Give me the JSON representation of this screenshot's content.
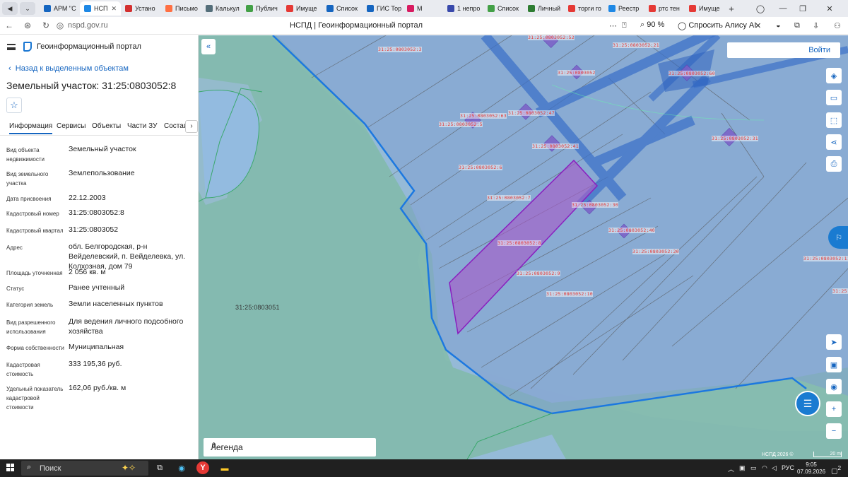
{
  "browser": {
    "tabs": [
      {
        "label": "АРМ \"С",
        "color": "#1565c0"
      },
      {
        "label": "НСП",
        "color": "#1e88e5",
        "active": true
      },
      {
        "label": "Устано",
        "color": "#d32f2f"
      },
      {
        "label": "Письмо",
        "color": "#ff7043"
      },
      {
        "label": "Калькул",
        "color": "#546e7a"
      },
      {
        "label": "Публич",
        "color": "#43a047"
      },
      {
        "label": "Имуще",
        "color": "#e53935"
      },
      {
        "label": "Список",
        "color": "#1565c0"
      },
      {
        "label": "ГИС Тор",
        "color": "#1565c0"
      },
      {
        "label": "М",
        "color": "#d81b60"
      },
      {
        "label": "1 непро",
        "color": "#3949ab"
      },
      {
        "label": "Список",
        "color": "#43a047"
      },
      {
        "label": "Личный",
        "color": "#2e7d32"
      },
      {
        "label": "торги го",
        "color": "#e53935"
      },
      {
        "label": "Реестр",
        "color": "#1e88e5"
      },
      {
        "label": "ртс тен",
        "color": "#e53935"
      },
      {
        "label": "Имуще",
        "color": "#e53935"
      }
    ],
    "url": "nspd.gov.ru",
    "page_title": "НСПД | Геоинформационный портал",
    "zoom": "90 %",
    "alice": "Спросить Алису AI"
  },
  "panel": {
    "portal_name": "Геоинформационный портал",
    "back_link": "Назад к выделенным объектам",
    "title": "Земельный участок: 31:25:0803052:8",
    "tabs": [
      "Информация",
      "Сервисы",
      "Объекты",
      "Части ЗУ",
      "Состав"
    ],
    "attributes": [
      {
        "label": "Вид объекта недвижимости",
        "value": "Земельный участок"
      },
      {
        "label": "Вид земельного участка",
        "value": "Землепользование"
      },
      {
        "label": "Дата присвоения",
        "value": "22.12.2003"
      },
      {
        "label": "Кадастровый номер",
        "value": "31:25:0803052:8"
      },
      {
        "label": "Кадастровый квартал",
        "value": "31:25:0803052"
      },
      {
        "label": "Адрес",
        "value": "обл. Белгородская, р-н Вейделевский, п. Вейделевка, ул. Колхозная, дом 79"
      },
      {
        "label": "Площадь уточненная",
        "value": "2 056 кв. м"
      },
      {
        "label": "Статус",
        "value": "Ранее учтенный"
      },
      {
        "label": "Категория земель",
        "value": "Земли населенных пунктов"
      },
      {
        "label": "Вид разрешенного использования",
        "value": "Для ведения личного подсобного хозяйства"
      },
      {
        "label": "Форма собственности",
        "value": "Муниципальная"
      },
      {
        "label": "Кадастровая стоимость",
        "value": "333 195,36 руб."
      },
      {
        "label": "Удельный показатель кадастровой стоимости",
        "value": "162,06 руб./кв. м"
      }
    ]
  },
  "map": {
    "login": "Войти",
    "legend": "Легенда",
    "copyright": "НСПД 2026 ©",
    "scale": "20 m",
    "quarter_label": "31:25:0803051",
    "parcel_labels": [
      "31:25:0803052:52",
      "31:25:0803052:3",
      "31:25:0803052:21",
      "31:25:0803052",
      "31:25:0803052:60",
      "31:25:0803052:63",
      "31:25:0803052:47",
      "31:25:0803052:5",
      "31:25:0803052:31",
      "31:25:0803052:41",
      "31:25:0803052:6",
      "31:25:0803052:7",
      "31:25:0803052:30",
      "31:25:0803052:40",
      "31:25:0803052:8",
      "31:25:0803052:20",
      "31:25:0803052:9",
      "31:25:0803052:10",
      "31:25:0803052:11",
      "31:25:080"
    ]
  },
  "taskbar": {
    "search": "Поиск",
    "lang": "РУС",
    "time": "9:05",
    "date": "07.09.2026",
    "notifications": "2"
  }
}
